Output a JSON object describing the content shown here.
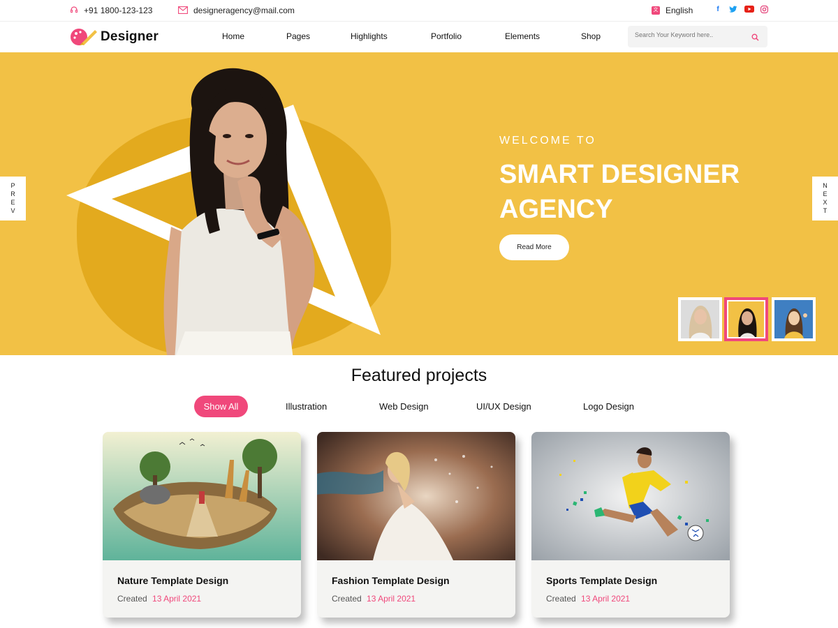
{
  "topbar": {
    "phone": "+91 1800-123-123",
    "email": "designeragency@mail.com",
    "language": "English",
    "socials": [
      "facebook-icon",
      "twitter-icon",
      "youtube-icon",
      "instagram-icon"
    ]
  },
  "nav": {
    "logo_text": "Designer",
    "items": [
      "Home",
      "Pages",
      "Highlights",
      "Portfolio",
      "Elements",
      "Shop"
    ],
    "search_placeholder": "Search Your Keyword here.."
  },
  "hero": {
    "welcome": "WELCOME TO",
    "headline": "SMART DESIGNER AGENCY",
    "button": "Read More",
    "prev": [
      "P",
      "R",
      "E",
      "V"
    ],
    "next": [
      "N",
      "E",
      "X",
      "T"
    ]
  },
  "featured": {
    "title": "Featured projects",
    "filters": [
      "Show All",
      "Illustration",
      "Web Design",
      "UI/UX Design",
      "Logo Design"
    ],
    "cards": [
      {
        "title": "Nature Template Design",
        "created_label": "Created",
        "date": "13 April 2021"
      },
      {
        "title": "Fashion Template Design",
        "created_label": "Created",
        "date": "13 April 2021"
      },
      {
        "title": "Sports Template Design",
        "created_label": "Created",
        "date": "13 April 2021"
      }
    ]
  },
  "colors": {
    "accent": "#f0487b",
    "hero_bg": "#f2c145",
    "splash": "#e1a91c"
  }
}
